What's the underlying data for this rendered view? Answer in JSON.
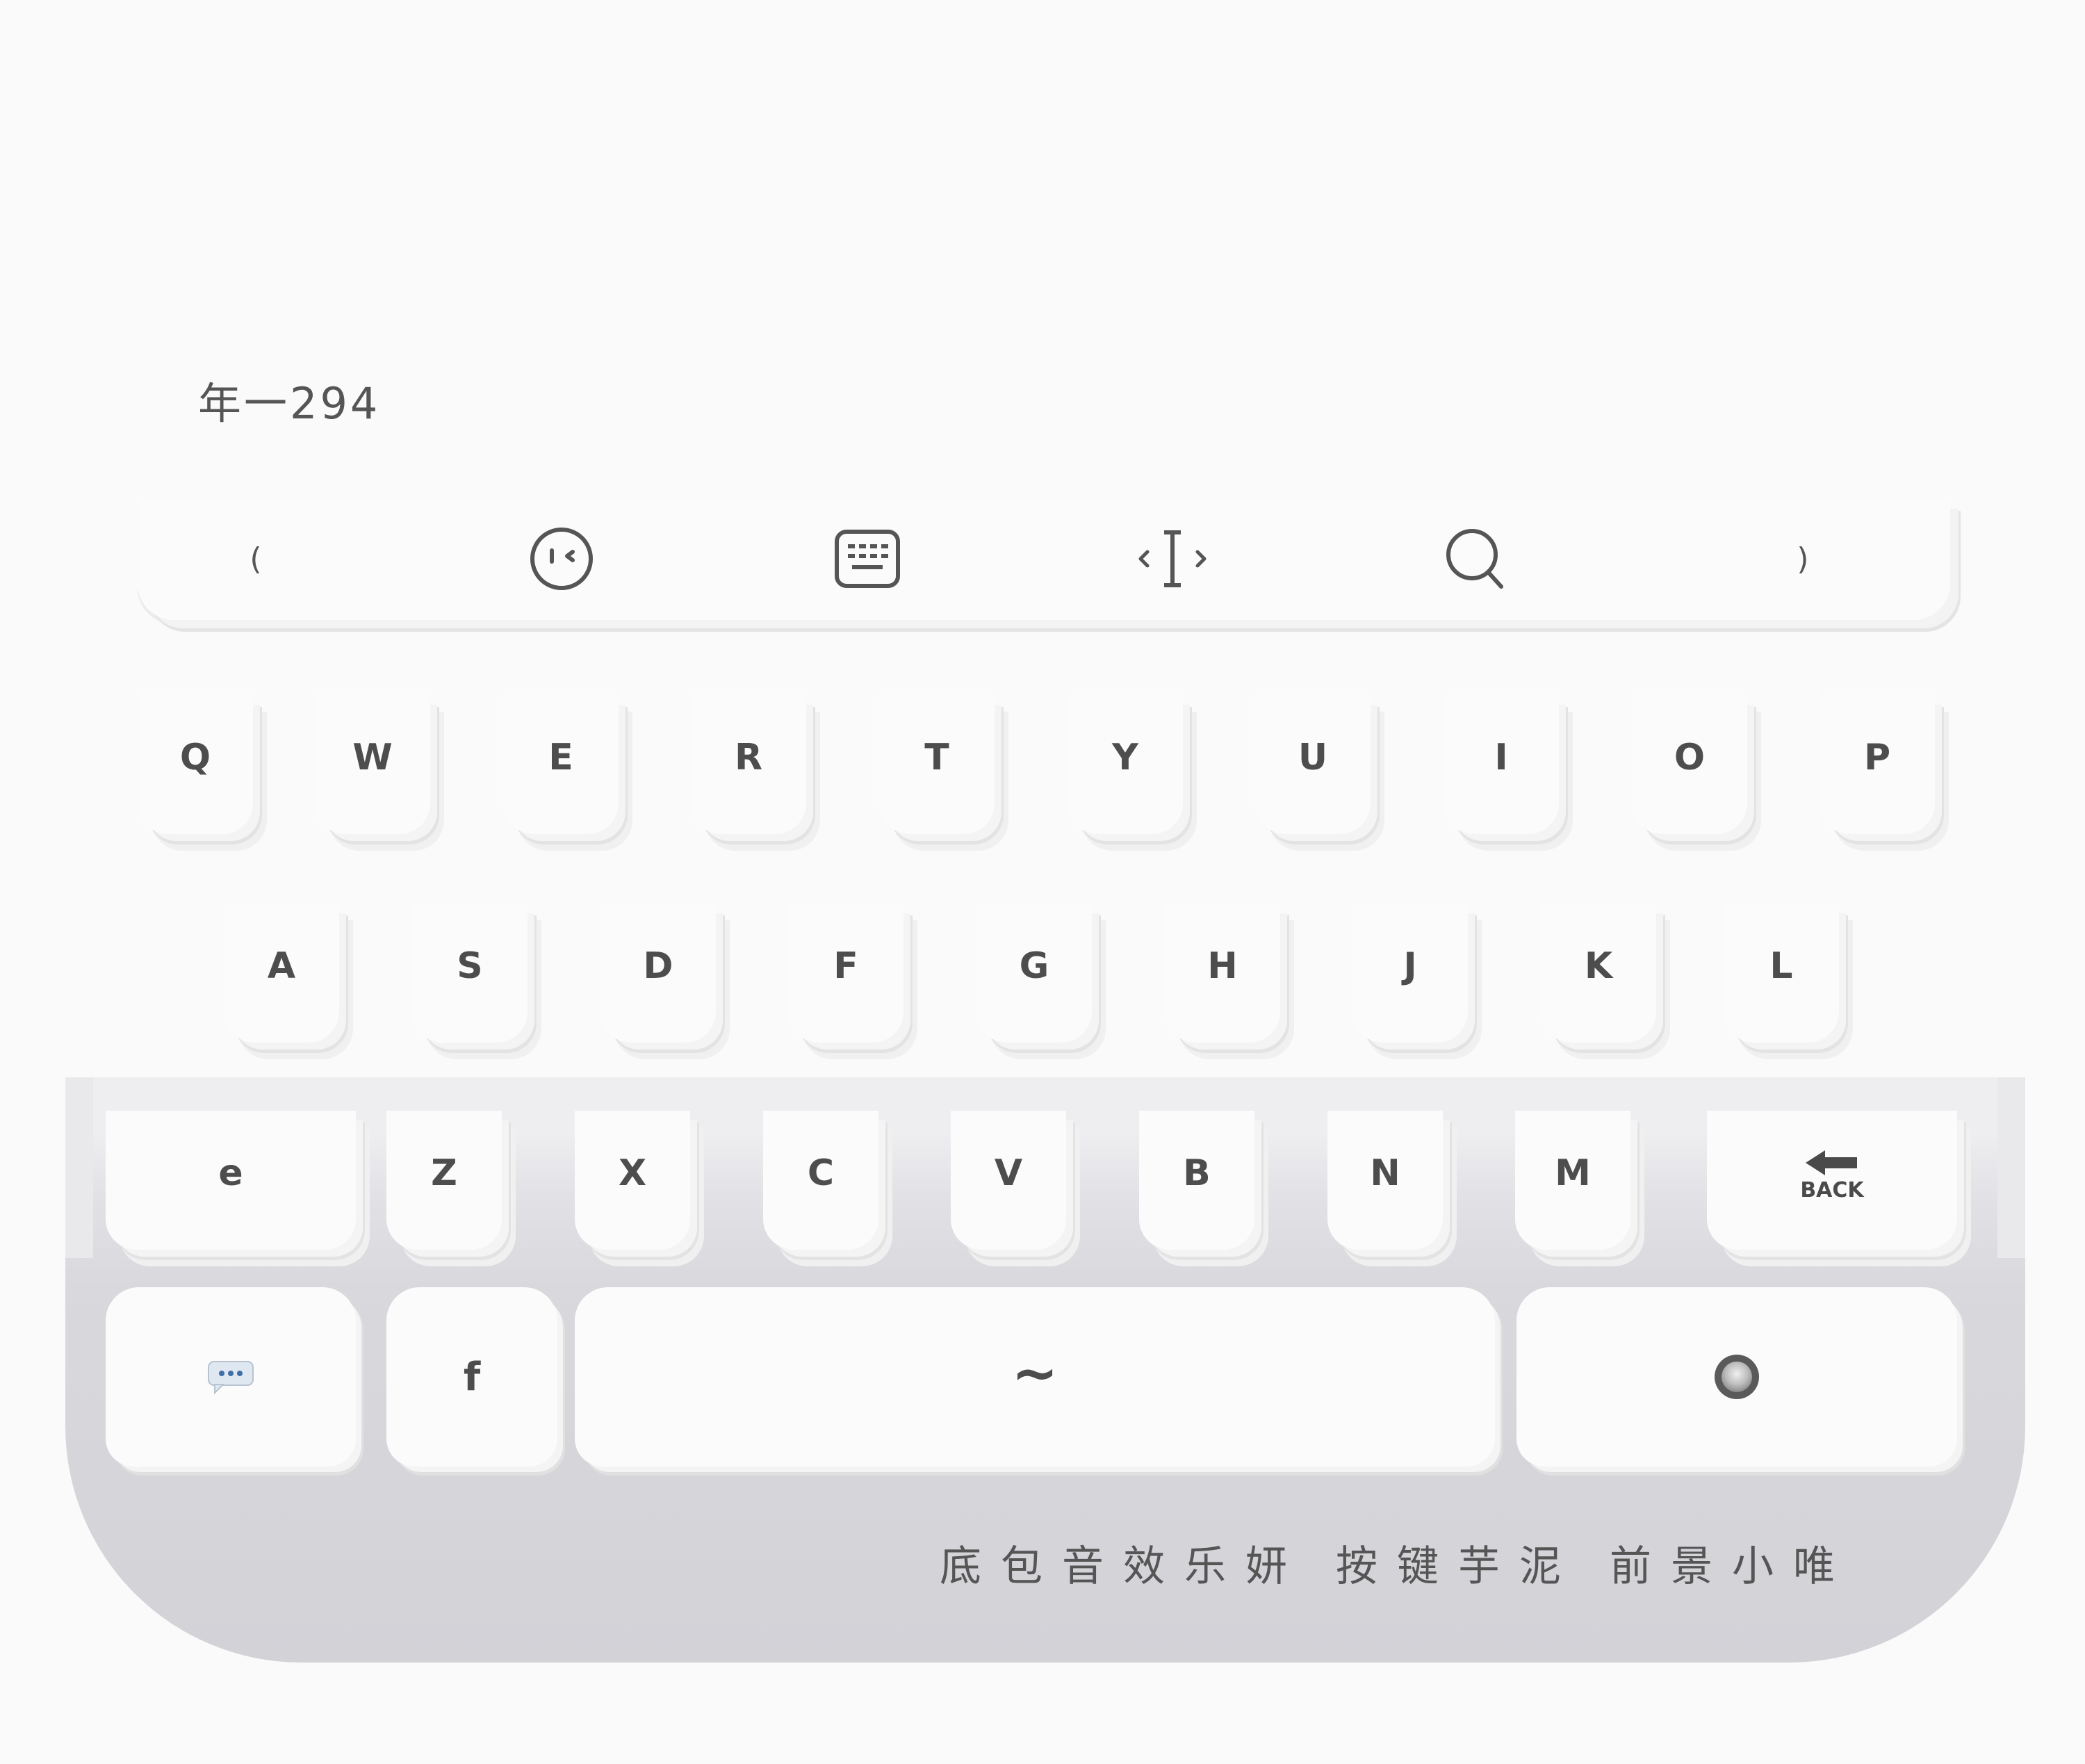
{
  "header": {
    "label": "年一294"
  },
  "toolbar": {
    "left_paren": "(",
    "right_paren": ")",
    "items": [
      {
        "icon": "emoji-face-icon"
      },
      {
        "icon": "keyboard-icon"
      },
      {
        "icon": "text-cursor-icon"
      },
      {
        "icon": "search-icon"
      }
    ]
  },
  "rows": {
    "row1": [
      "Q",
      "W",
      "E",
      "R",
      "T",
      "Y",
      "U",
      "I",
      "O",
      "P"
    ],
    "row2": [
      "A",
      "S",
      "D",
      "F",
      "G",
      "H",
      "J",
      "K",
      "L"
    ],
    "row3": [
      "Z",
      "X",
      "C",
      "V",
      "B",
      "N",
      "M"
    ]
  },
  "keys": {
    "shift_label": "e",
    "back_label": "BACK",
    "symbol_label": "f",
    "space_label": "~",
    "chat_icon": "speech-bubble-icon",
    "enter_icon": "circle-button-icon"
  },
  "branding": {
    "part1": "底包音效乐妍",
    "part2": "按键芋泥",
    "part3": "前景小唯"
  },
  "colors": {
    "background": "#fafafa",
    "key_face": "#fbfbfb",
    "keyboard_shell": "#d2d2d7",
    "text": "#4d4d4d"
  }
}
